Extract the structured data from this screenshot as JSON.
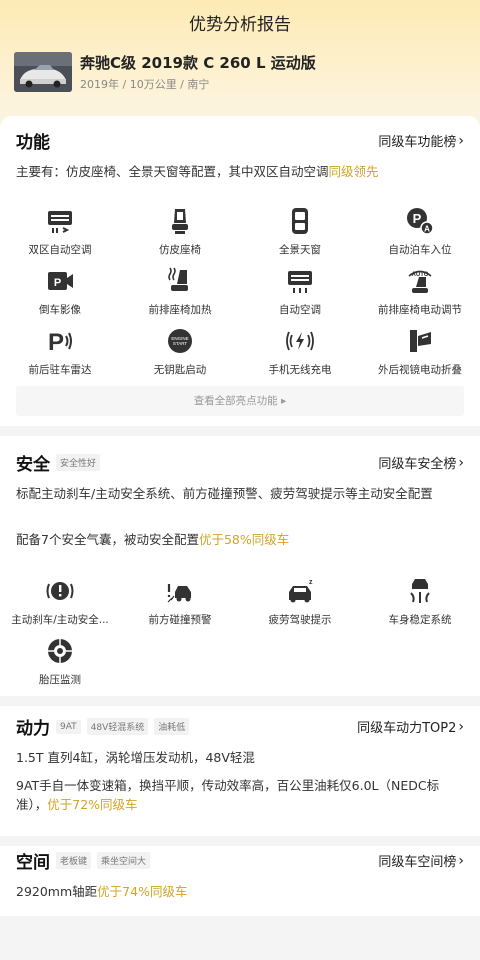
{
  "header": {
    "title": "优势分析报告"
  },
  "car": {
    "name": "奔驰C级 2019款 C 260 L 运动版",
    "meta": "2019年 / 10万公里 / 南宁"
  },
  "features": {
    "title": "功能",
    "rank_link": "同级车功能榜",
    "desc_prefix": "主要有：仿皮座椅、全景天窗等配置，其中双区自动空调",
    "desc_highlight": "同级领先",
    "items": [
      {
        "label": "双区自动空调",
        "icon": "dual-ac-icon"
      },
      {
        "label": "仿皮座椅",
        "icon": "seat-icon"
      },
      {
        "label": "全景天窗",
        "icon": "sunroof-icon"
      },
      {
        "label": "自动泊车入位",
        "icon": "auto-park-icon"
      },
      {
        "label": "倒车影像",
        "icon": "reverse-camera-icon"
      },
      {
        "label": "前排座椅加热",
        "icon": "seat-heating-icon"
      },
      {
        "label": "自动空调",
        "icon": "ac-icon"
      },
      {
        "label": "前排座椅电动调节",
        "icon": "seat-adjust-icon"
      },
      {
        "label": "前后驻车雷达",
        "icon": "parking-radar-icon"
      },
      {
        "label": "无钥匙启动",
        "icon": "keyless-start-icon"
      },
      {
        "label": "手机无线充电",
        "icon": "wireless-charge-icon"
      },
      {
        "label": "外后视镜电动折叠",
        "icon": "mirror-fold-icon"
      }
    ],
    "view_all": "查看全部亮点功能"
  },
  "safety": {
    "title": "安全",
    "tag": "安全性好",
    "rank_link": "同级车安全榜",
    "desc1": "标配主动刹车/主动安全系统、前方碰撞预警、疲劳驾驶提示等主动安全配置",
    "desc2_prefix": "配备7个安全气囊，被动安全配置",
    "desc2_highlight": "优于58%同级车",
    "items": [
      {
        "label": "主动刹车/主动安全...",
        "icon": "active-brake-icon"
      },
      {
        "label": "前方碰撞预警",
        "icon": "collision-warning-icon"
      },
      {
        "label": "疲劳驾驶提示",
        "icon": "fatigue-icon"
      },
      {
        "label": "车身稳定系统",
        "icon": "stability-icon"
      },
      {
        "label": "胎压监测",
        "icon": "tire-pressure-icon"
      }
    ]
  },
  "power": {
    "title": "动力",
    "tags": [
      "9AT",
      "48V轻混系统",
      "油耗低"
    ],
    "rank_link": "同级车动力TOP2",
    "desc1": "1.5T 直列4缸，涡轮增压发动机，48V轻混",
    "desc2_prefix": "9AT手自一体变速箱，换挡平顺，传动效率高，百公里油耗仅6.0L（NEDC标准），",
    "desc2_highlight": "优于72%同级车"
  },
  "space": {
    "title": "空间",
    "tags": [
      "老板键",
      "乘坐空间大"
    ],
    "rank_link": "同级车空间榜",
    "desc_prefix": "2920mm轴距",
    "desc_highlight": "优于74%同级车"
  }
}
